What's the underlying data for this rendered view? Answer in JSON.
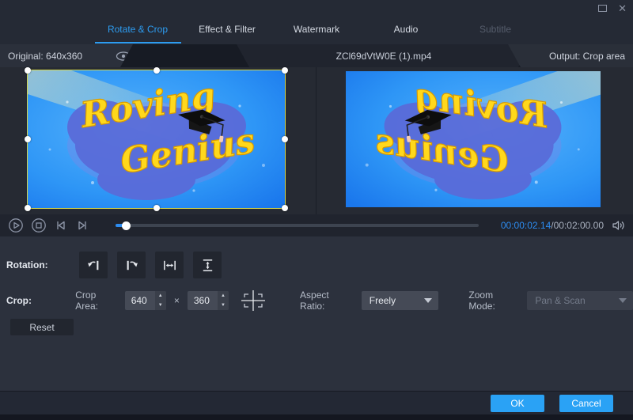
{
  "window": {
    "close_icon": "✕"
  },
  "tabs": [
    {
      "label": "Rotate & Crop"
    },
    {
      "label": "Effect & Filter"
    },
    {
      "label": "Watermark"
    },
    {
      "label": "Audio"
    },
    {
      "label": "Subtitle"
    }
  ],
  "header": {
    "original": "Original: 640x360",
    "filename": "ZCl69dVtW0E (1).mp4",
    "output": "Output: Crop area"
  },
  "video": {
    "title_line1": "Roving",
    "title_line2": "Genius"
  },
  "playback": {
    "current_time": "00:00:02.14",
    "time_separator": "/",
    "total_time": "00:02:00.00",
    "progress_percent": 3
  },
  "rotation": {
    "label": "Rotation:"
  },
  "crop": {
    "label": "Crop:",
    "area_label": "Crop Area:",
    "width": "640",
    "times": "×",
    "height": "360",
    "aspect_ratio_label": "Aspect Ratio:",
    "aspect_ratio": "Freely",
    "zoom_mode_label": "Zoom Mode:",
    "zoom_mode": "Pan & Scan",
    "reset": "Reset"
  },
  "footer": {
    "ok": "OK",
    "cancel": "Cancel"
  },
  "icons": {
    "spinner_up": "▲",
    "spinner_down": "▼"
  },
  "colors": {
    "accent_blue": "#2d9cf0",
    "button_blue": "#2aa2f5",
    "crop_border_yellow": "#d2d44b",
    "video_text_yellow": "#ffd81c",
    "video_bg_blue": "#2e96f6",
    "blob_purple": "#5b6ad8"
  }
}
